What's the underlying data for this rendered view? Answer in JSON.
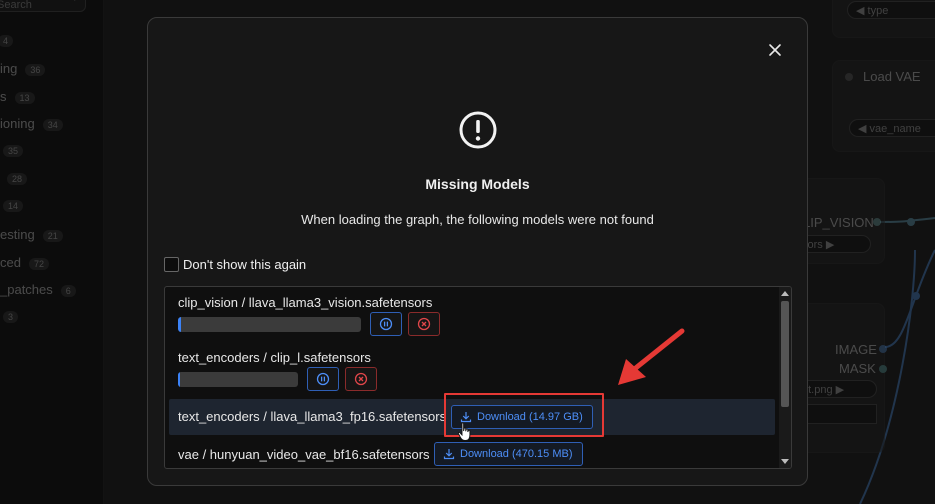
{
  "sidebar": {
    "search_placeholder": "Search",
    "items": [
      {
        "label": "",
        "count": "4"
      },
      {
        "label": "ing",
        "count": "36"
      },
      {
        "label": "s",
        "count": "13"
      },
      {
        "label": "ioning",
        "count": "34"
      },
      {
        "label": "",
        "count": "35"
      },
      {
        "label": "",
        "count": "28"
      },
      {
        "label": "",
        "count": "14"
      },
      {
        "label": "esting",
        "count": "21"
      },
      {
        "label": "ced",
        "count": "72"
      },
      {
        "label": "_patches",
        "count": "6"
      },
      {
        "label": "",
        "count": "3"
      }
    ]
  },
  "canvas": {
    "top_widget": "type",
    "load_vae_title": "Load VAE",
    "vae_name_widget": "vae_name",
    "clip_vision_output": "LIP_VISION",
    "sors_widget": "sors",
    "image_output": "IMAGE",
    "mask_output": "MASK",
    "png_widget": "et.png"
  },
  "dialog": {
    "title": "Missing Models",
    "message": "When loading the graph, the following models were not found",
    "dont_show_label": "Don't show this again",
    "models": [
      {
        "name": "clip_vision / llava_llama3_vision.safetensors",
        "state": "downloading",
        "progress": 0.01
      },
      {
        "name": "text_encoders / clip_l.safetensors",
        "state": "downloading",
        "progress": 0.01
      },
      {
        "name": "text_encoders / llava_llama3_fp16.safetensors",
        "state": "available",
        "download_label": "Download (14.97 GB)"
      },
      {
        "name": "vae / hunyuan_video_vae_bf16.safetensors",
        "state": "available",
        "download_label": "Download (470.15 MB)"
      }
    ]
  },
  "colors": {
    "accent_blue": "#3b82f6",
    "cancel_red": "#e0464a",
    "annotation_red": "#e53935"
  },
  "icons": [
    "search-icon",
    "close-icon",
    "warning-circle-icon",
    "pause-icon",
    "cancel-icon",
    "download-icon",
    "hand-cursor-icon"
  ]
}
